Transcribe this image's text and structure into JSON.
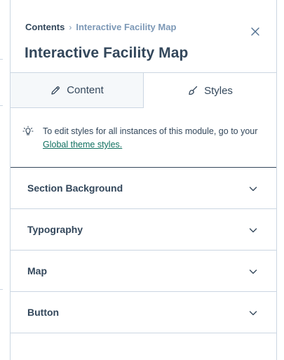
{
  "breadcrumb": {
    "root": "Contents",
    "separator": "›",
    "current": "Interactive Facility Map"
  },
  "title": "Interactive Facility Map",
  "close_icon": "close-icon",
  "tabs": [
    {
      "label": "Content",
      "icon": "pencil-icon",
      "active": false
    },
    {
      "label": "Styles",
      "icon": "brush-icon",
      "active": true
    }
  ],
  "notice": {
    "icon": "lightbulb-icon",
    "text": "To edit styles for all instances of this module, go to your ",
    "link_text": "Global theme styles."
  },
  "sections": [
    {
      "label": "Section Background",
      "icon": "chevron-down-icon"
    },
    {
      "label": "Typography",
      "icon": "chevron-down-icon"
    },
    {
      "label": "Map",
      "icon": "chevron-down-icon"
    },
    {
      "label": "Button",
      "icon": "chevron-down-icon"
    }
  ],
  "colors": {
    "text": "#33475b",
    "muted": "#7c98b6",
    "border": "#cbd6e2",
    "link": "#0f6f5f",
    "tab_inactive_bg": "#f5f8fa"
  }
}
